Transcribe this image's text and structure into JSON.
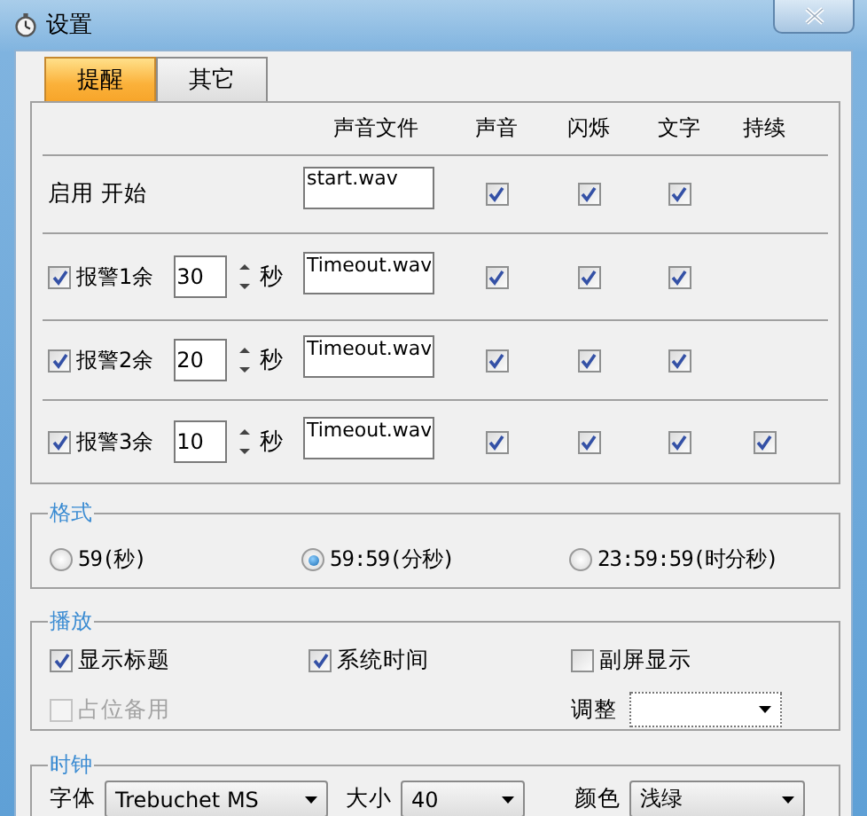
{
  "window": {
    "title": "设置"
  },
  "tabs": [
    {
      "label": "提醒",
      "selected": true
    },
    {
      "label": "其它",
      "selected": false
    }
  ],
  "alerts": {
    "columns": [
      "声音文件",
      "声音",
      "闪烁",
      "文字",
      "持续"
    ],
    "rows": [
      {
        "kind": "start",
        "label": "启用 开始",
        "sound_file": "start.wav",
        "sound": true,
        "flash": true,
        "text": true
      },
      {
        "kind": "timer",
        "enabled": true,
        "label": "报警1余",
        "seconds": "30",
        "unit": "秒",
        "sound_file": "Timeout.wav",
        "sound": true,
        "flash": true,
        "text": true
      },
      {
        "kind": "timer",
        "enabled": true,
        "label": "报警2余",
        "seconds": "20",
        "unit": "秒",
        "sound_file": "Timeout.wav",
        "sound": true,
        "flash": true,
        "text": true
      },
      {
        "kind": "timer",
        "enabled": true,
        "label": "报警3余",
        "seconds": "10",
        "unit": "秒",
        "sound_file": "Timeout.wav",
        "sound": true,
        "flash": true,
        "text": true,
        "persist": true
      }
    ]
  },
  "format": {
    "title": "格式",
    "options": [
      {
        "label": "59(秒)",
        "selected": false
      },
      {
        "label": "59:59(分秒)",
        "selected": true
      },
      {
        "label": "23:59:59(时分秒)",
        "selected": false
      }
    ]
  },
  "playback": {
    "title": "播放",
    "options": [
      {
        "label": "显示标题",
        "checked": true,
        "disabled": false
      },
      {
        "label": "系统时间",
        "checked": true,
        "disabled": false
      },
      {
        "label": "副屏显示",
        "checked": false,
        "disabled": false
      },
      {
        "label": "占位备用",
        "checked": false,
        "disabled": true
      }
    ],
    "adjust": {
      "label": "调整"
    }
  },
  "clock": {
    "title": "时钟",
    "fields": [
      {
        "label": "字体",
        "value": "Trebuchet MS"
      },
      {
        "label": "大小",
        "value": "40"
      },
      {
        "label": "颜色",
        "value": "浅绿"
      }
    ]
  }
}
